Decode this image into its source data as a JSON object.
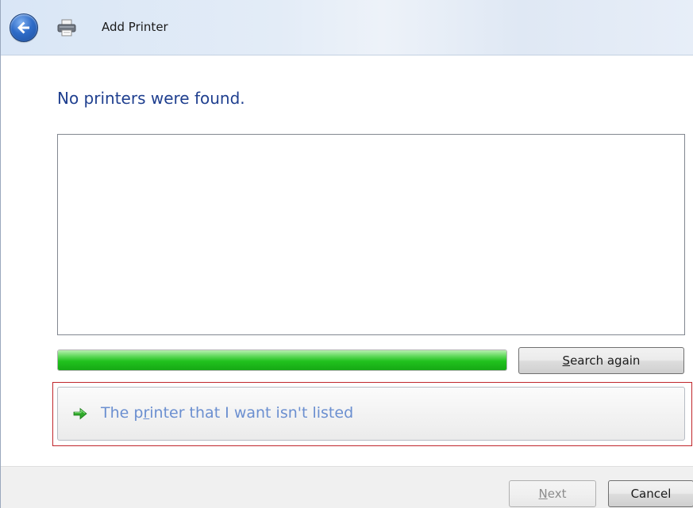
{
  "window": {
    "title": "Add Printer",
    "back_icon": "back-arrow-icon",
    "app_icon": "printer-icon"
  },
  "content": {
    "heading": "No printers were found.",
    "progress_fill_fraction": 1.0,
    "search_button": {
      "before": "",
      "mnemonic": "S",
      "after": "earch again"
    },
    "command_link": {
      "icon": "green-arrow-icon",
      "before": "The p",
      "mnemonic": "r",
      "after": "inter that I want isn't listed"
    }
  },
  "footer": {
    "next_button": {
      "mnemonic": "N",
      "after": "ext"
    },
    "cancel_label": "Cancel"
  },
  "colors": {
    "heading": "#1f3f8f",
    "progress": "#21c21e",
    "highlight_border": "#c0262b",
    "command_link_text": "#6b8fd0"
  }
}
